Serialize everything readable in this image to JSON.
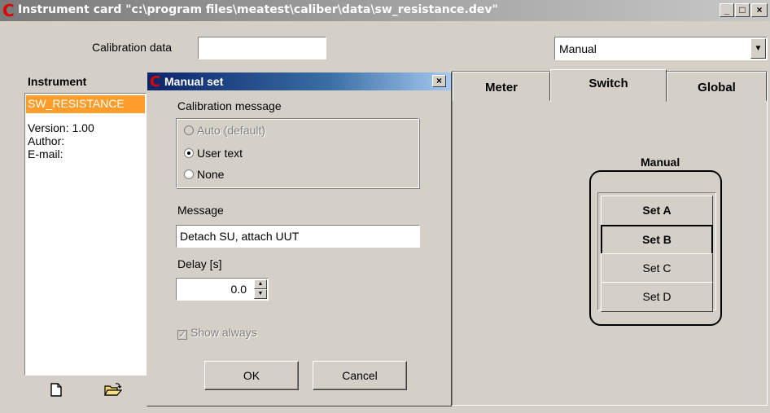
{
  "window": {
    "title": "Instrument card \"c:\\program files\\meatest\\caliber\\data\\sw_resistance.dev\"",
    "logo_letter": "C",
    "minimize_glyph": "_",
    "maximize_glyph": "□",
    "close_glyph": "×"
  },
  "calibration": {
    "label": "Calibration data",
    "value": ""
  },
  "mode_select": {
    "value": "Manual",
    "arrow_glyph": "▼"
  },
  "instrument_panel": {
    "header": "Instrument",
    "selected_item": "SW_RESISTANCE",
    "version": "Version: 1.00",
    "author": "Author:",
    "email": "E-mail:",
    "icons": [
      "new-file-icon",
      "open-folder-icon"
    ]
  },
  "tabs": [
    {
      "label": "Meter",
      "active": false
    },
    {
      "label": "Switch",
      "active": true
    },
    {
      "label": "Global",
      "active": false
    }
  ],
  "switch_panel": {
    "title": "Manual",
    "buttons": [
      {
        "label": "Set A",
        "bold": true,
        "pressed": false
      },
      {
        "label": "Set B",
        "bold": true,
        "pressed": true
      },
      {
        "label": "Set C",
        "bold": false,
        "pressed": false
      },
      {
        "label": "Set D",
        "bold": false,
        "pressed": false
      }
    ]
  },
  "dialog": {
    "title": "Manual set",
    "close_glyph": "×",
    "calibration_message_label": "Calibration message",
    "radios": [
      {
        "label": "Auto (default)",
        "checked": false,
        "disabled": true
      },
      {
        "label": "User text",
        "checked": true,
        "disabled": false
      },
      {
        "label": "None",
        "checked": false,
        "disabled": false
      }
    ],
    "message_label": "Message",
    "message_value": "Detach SU, attach UUT",
    "delay_label": "Delay [s]",
    "delay_value": "0.0",
    "show_always_label": "Show always",
    "show_always_checked": true,
    "ok_label": "OK",
    "cancel_label": "Cancel"
  },
  "colors": {
    "selection": "#ff9d2b",
    "dialog_title_start": "#0a246a",
    "logo": "#e00000",
    "face": "#d4d0c8"
  }
}
